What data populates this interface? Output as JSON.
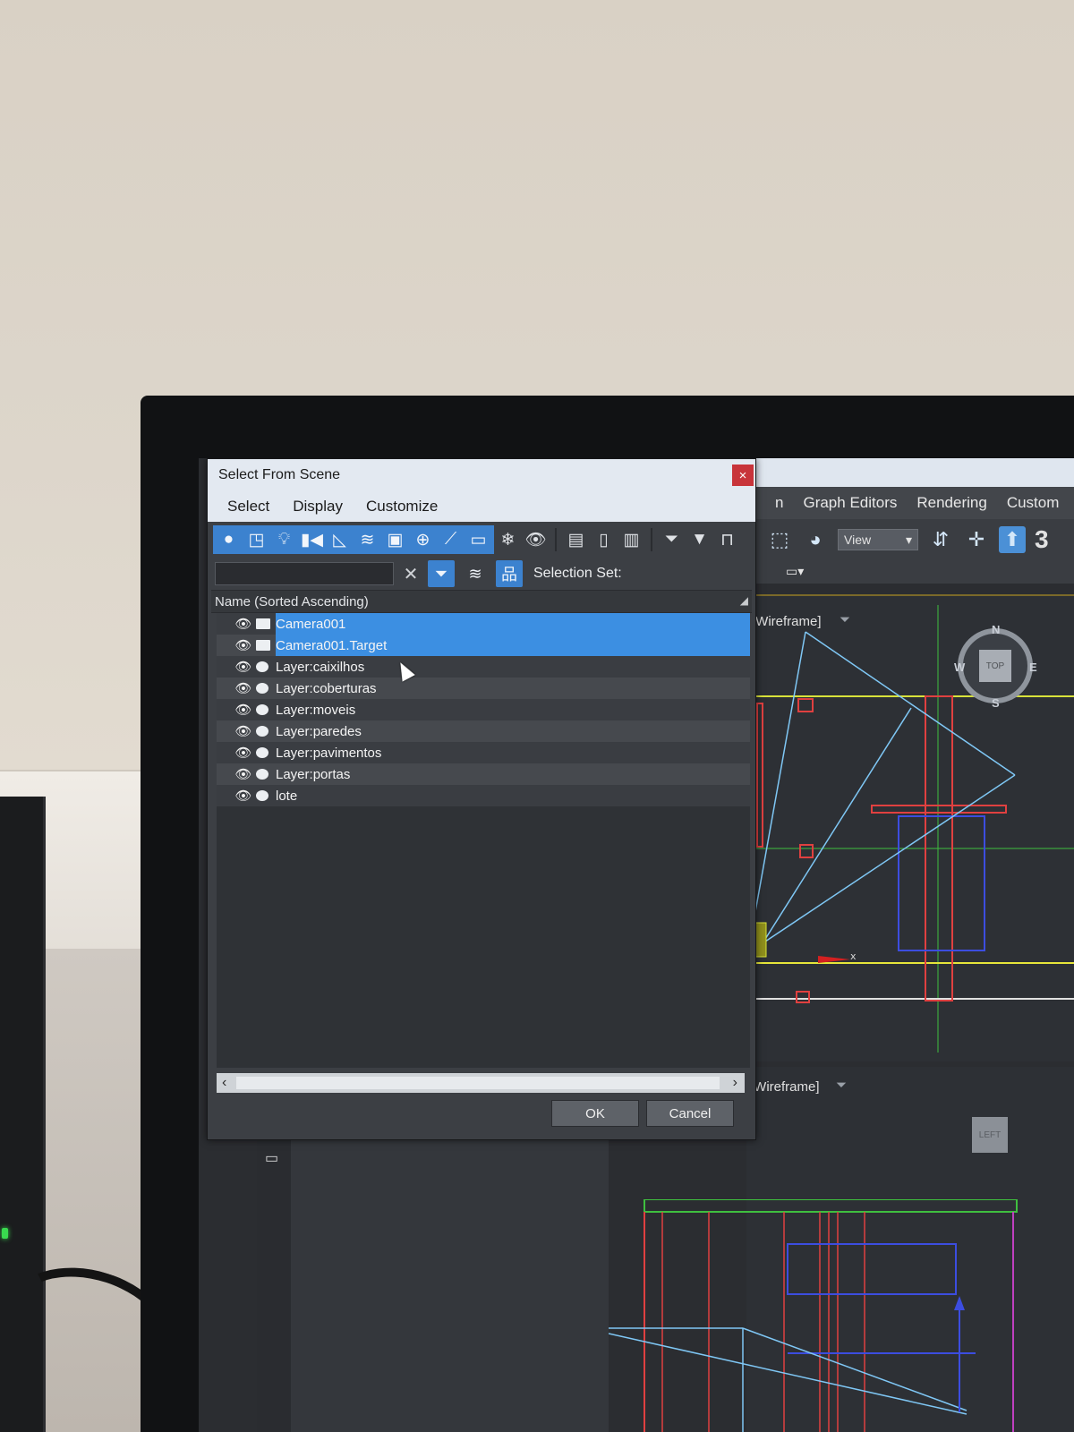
{
  "dialog": {
    "title": "Select From Scene",
    "close_glyph": "×",
    "menu": [
      "Select",
      "Display",
      "Customize"
    ],
    "selection_set_label": "Selection Set:",
    "search_value": "",
    "list_header": "Name (Sorted Ascending)",
    "items": [
      {
        "label": "Camera001",
        "type": "camera",
        "selected": true
      },
      {
        "label": "Camera001.Target",
        "type": "camera",
        "selected": true
      },
      {
        "label": "Layer:caixilhos",
        "type": "layer",
        "selected": false
      },
      {
        "label": "Layer:coberturas",
        "type": "layer",
        "selected": false
      },
      {
        "label": "Layer:moveis",
        "type": "layer",
        "selected": false
      },
      {
        "label": "Layer:paredes",
        "type": "layer",
        "selected": false
      },
      {
        "label": "Layer:pavimentos",
        "type": "layer",
        "selected": false
      },
      {
        "label": "Layer:portas",
        "type": "layer",
        "selected": false
      },
      {
        "label": "lote",
        "type": "layer",
        "selected": false
      }
    ],
    "ok_label": "OK",
    "cancel_label": "Cancel"
  },
  "app": {
    "menu": [
      "n",
      "Graph Editors",
      "Rendering",
      "Custom"
    ],
    "view_dropdown": "View",
    "toolbar_number": "3",
    "viewport_top_label": "[Wireframe]",
    "viewport_left_label": "[Wireframe]",
    "viewcube_top_face": "TOP",
    "viewcube_left_face": "LEFT",
    "compass": {
      "n": "N",
      "s": "S",
      "e": "E",
      "w": "W"
    }
  },
  "colors": {
    "accent": "#3c82cf",
    "selection": "#3c8fe2",
    "close": "#c8343a"
  }
}
